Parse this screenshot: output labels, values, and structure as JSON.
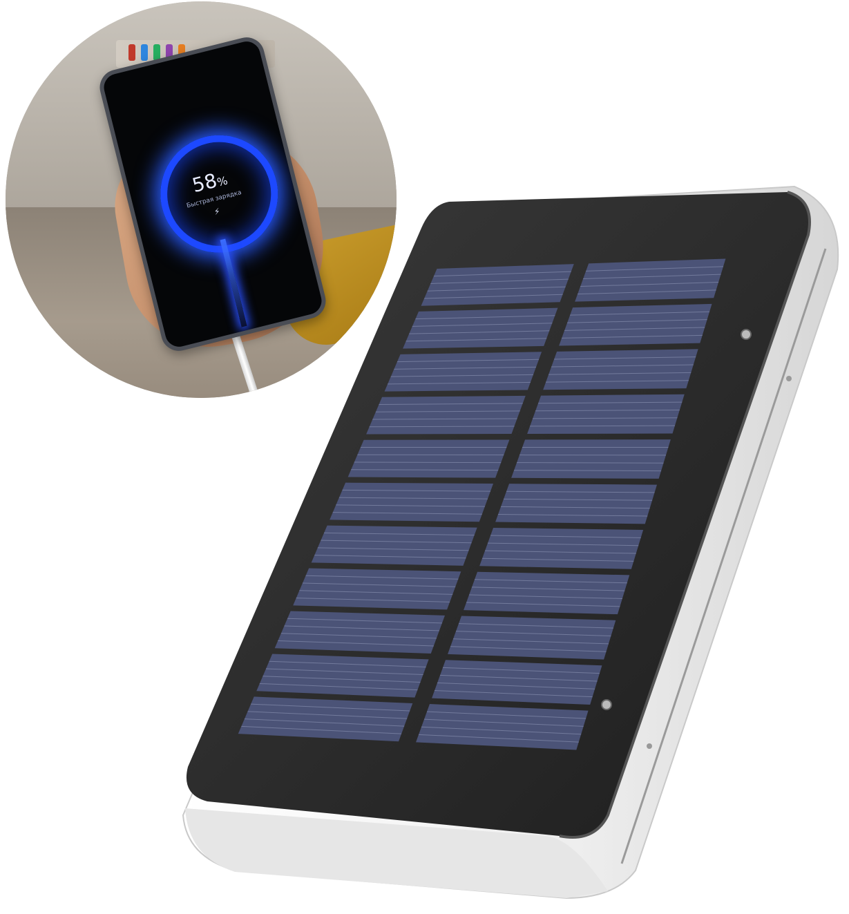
{
  "inset_photo": {
    "phone_screen": {
      "percent_value": "58",
      "percent_sign": "%",
      "status_text": "Быстрая зарядка",
      "charging_icon": "bolt-icon"
    }
  },
  "product": {
    "panel_rows": 11,
    "panel_columns": 2,
    "colors": {
      "panel_cell": "#4b5377",
      "panel_line": "#8e96b6",
      "frame": "#2b2b2b",
      "body_shell": "#f2f2f2"
    }
  }
}
